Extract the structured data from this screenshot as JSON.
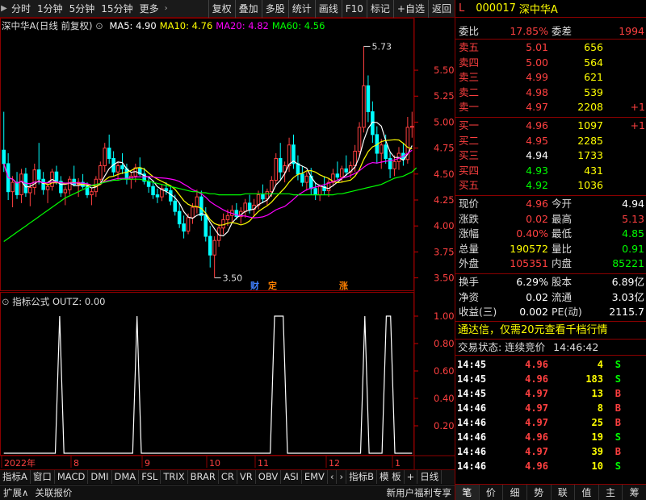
{
  "toolbar": {
    "left_items": [
      "分时",
      "1分钟",
      "5分钟",
      "15分钟",
      "更多"
    ],
    "right_items": [
      "复权",
      "叠加",
      "多股",
      "统计",
      "画线",
      "F10",
      "标记",
      "+自选",
      "返回"
    ]
  },
  "main_chart": {
    "stock_label": "深中华A(日线 前复权)",
    "ma": [
      {
        "label": "MA5: 4.90",
        "color": "#ffffff"
      },
      {
        "label": "MA10: 4.76",
        "color": "#ffff00"
      },
      {
        "label": "MA20: 4.82",
        "color": "#ff00ff"
      },
      {
        "label": "MA60: 4.56",
        "color": "#00ff00"
      }
    ],
    "high_label": "5.73",
    "low_label": "3.50",
    "markers": [
      "财",
      "定",
      "涨"
    ]
  },
  "chart_data": [
    {
      "type": "candlestick",
      "x_axis_labels": [
        "2022年",
        "8",
        "9",
        "10",
        "11",
        "12",
        "1"
      ],
      "y_ticks": [
        3.5,
        3.75,
        4.0,
        4.25,
        4.5,
        4.75,
        5.0,
        5.25,
        5.5
      ],
      "ylim": [
        3.38,
        5.85
      ],
      "ohlc": [
        [
          4.73,
          5.1,
          4.52,
          4.6
        ],
        [
          4.6,
          4.7,
          4.25,
          4.33
        ],
        [
          4.33,
          4.48,
          4.18,
          4.42
        ],
        [
          4.42,
          4.52,
          4.26,
          4.3
        ],
        [
          4.3,
          4.55,
          4.22,
          4.5
        ],
        [
          4.5,
          4.56,
          4.28,
          4.32
        ],
        [
          4.32,
          4.4,
          4.19,
          4.37
        ],
        [
          4.37,
          4.6,
          4.3,
          4.54
        ],
        [
          4.54,
          4.8,
          4.4,
          4.45
        ],
        [
          4.45,
          4.52,
          4.3,
          4.35
        ],
        [
          4.35,
          4.42,
          4.22,
          4.38
        ],
        [
          4.38,
          4.55,
          4.34,
          4.52
        ],
        [
          4.52,
          4.58,
          4.4,
          4.43
        ],
        [
          4.43,
          4.48,
          4.28,
          4.32
        ],
        [
          4.32,
          4.38,
          4.2,
          4.35
        ],
        [
          4.35,
          4.48,
          4.3,
          4.45
        ],
        [
          4.45,
          4.58,
          4.38,
          4.4
        ],
        [
          4.4,
          4.46,
          4.28,
          4.42
        ],
        [
          4.42,
          4.5,
          4.36,
          4.38
        ],
        [
          4.38,
          4.42,
          4.27,
          4.3
        ],
        [
          4.3,
          4.36,
          4.2,
          4.33
        ],
        [
          4.33,
          4.48,
          4.28,
          4.45
        ],
        [
          4.45,
          4.62,
          4.4,
          4.58
        ],
        [
          4.58,
          4.8,
          4.52,
          4.75
        ],
        [
          4.75,
          4.88,
          4.6,
          4.65
        ],
        [
          4.65,
          4.72,
          4.48,
          4.52
        ],
        [
          4.52,
          4.62,
          4.44,
          4.58
        ],
        [
          4.58,
          4.7,
          4.5,
          4.55
        ],
        [
          4.55,
          4.6,
          4.4,
          4.45
        ],
        [
          4.45,
          4.52,
          4.36,
          4.48
        ],
        [
          4.48,
          4.6,
          4.42,
          4.56
        ],
        [
          4.56,
          4.66,
          4.48,
          4.5
        ],
        [
          4.5,
          4.56,
          4.4,
          4.43
        ],
        [
          4.43,
          4.48,
          4.32,
          4.38
        ],
        [
          4.38,
          4.44,
          4.26,
          4.3
        ],
        [
          4.3,
          4.36,
          4.22,
          4.28
        ],
        [
          4.28,
          4.4,
          4.24,
          4.36
        ],
        [
          4.36,
          4.42,
          4.3,
          4.34
        ],
        [
          4.34,
          4.38,
          4.2,
          4.24
        ],
        [
          4.24,
          4.3,
          4.1,
          4.14
        ],
        [
          4.14,
          4.22,
          3.98,
          4.02
        ],
        [
          4.02,
          4.1,
          3.88,
          3.95
        ],
        [
          3.95,
          4.12,
          3.92,
          4.08
        ],
        [
          4.08,
          4.22,
          4.02,
          4.18
        ],
        [
          4.18,
          4.35,
          4.12,
          4.28
        ],
        [
          4.28,
          4.34,
          4.05,
          4.1
        ],
        [
          4.1,
          4.18,
          3.85,
          3.9
        ],
        [
          3.9,
          4.0,
          3.6,
          3.72
        ],
        [
          3.72,
          3.9,
          3.5,
          3.86
        ],
        [
          3.86,
          4.02,
          3.8,
          3.98
        ],
        [
          3.98,
          4.12,
          3.92,
          4.06
        ],
        [
          4.06,
          4.16,
          4.0,
          4.1
        ],
        [
          4.1,
          4.2,
          4.04,
          4.15
        ],
        [
          4.15,
          4.22,
          4.06,
          4.09
        ],
        [
          4.09,
          4.18,
          4.02,
          4.14
        ],
        [
          4.14,
          4.26,
          4.08,
          4.22
        ],
        [
          4.22,
          4.3,
          4.12,
          4.16
        ],
        [
          4.16,
          4.26,
          4.1,
          4.2
        ],
        [
          4.2,
          4.34,
          4.16,
          4.3
        ],
        [
          4.3,
          4.4,
          4.22,
          4.26
        ],
        [
          4.26,
          4.36,
          4.2,
          4.33
        ],
        [
          4.33,
          4.48,
          4.28,
          4.44
        ],
        [
          4.44,
          4.7,
          4.4,
          4.65
        ],
        [
          4.65,
          4.8,
          4.45,
          4.52
        ],
        [
          4.52,
          4.62,
          4.42,
          4.58
        ],
        [
          4.58,
          4.85,
          4.52,
          4.78
        ],
        [
          4.78,
          4.88,
          4.55,
          4.6
        ],
        [
          4.6,
          4.68,
          4.44,
          4.5
        ],
        [
          4.5,
          4.58,
          4.38,
          4.42
        ],
        [
          4.42,
          4.52,
          4.34,
          4.48
        ],
        [
          4.48,
          4.56,
          4.3,
          4.36
        ],
        [
          4.36,
          4.42,
          4.25,
          4.3
        ],
        [
          4.3,
          4.4,
          4.24,
          4.38
        ],
        [
          4.38,
          4.48,
          4.3,
          4.34
        ],
        [
          4.34,
          4.46,
          4.28,
          4.42
        ],
        [
          4.42,
          4.55,
          4.38,
          4.5
        ],
        [
          4.5,
          4.62,
          4.44,
          4.47
        ],
        [
          4.47,
          4.58,
          4.42,
          4.55
        ],
        [
          4.55,
          4.68,
          4.48,
          4.52
        ],
        [
          4.52,
          4.62,
          4.46,
          4.58
        ],
        [
          4.58,
          4.78,
          4.52,
          4.72
        ],
        [
          4.72,
          5.0,
          4.66,
          4.95
        ],
        [
          4.95,
          5.73,
          4.9,
          5.35
        ],
        [
          5.35,
          5.45,
          5.0,
          5.1
        ],
        [
          5.1,
          5.2,
          4.8,
          4.88
        ],
        [
          4.88,
          4.96,
          4.6,
          4.7
        ],
        [
          4.7,
          4.84,
          4.55,
          4.78
        ],
        [
          4.78,
          4.88,
          4.6,
          4.65
        ],
        [
          4.65,
          4.72,
          4.46,
          4.55
        ],
        [
          4.55,
          4.68,
          4.48,
          4.62
        ],
        [
          4.62,
          4.76,
          4.54,
          4.7
        ],
        [
          4.7,
          4.8,
          4.58,
          4.64
        ],
        [
          4.64,
          5.05,
          4.6,
          4.95
        ],
        [
          4.95,
          5.1,
          4.85,
          4.96
        ]
      ],
      "ma_series": [
        {
          "label": "MA5",
          "color": "#ffffff"
        },
        {
          "label": "MA10",
          "color": "#ffff00"
        },
        {
          "label": "MA20",
          "color": "#ff00ff"
        },
        {
          "label": "MA60",
          "color": "#00ff00",
          "values": [
            3.85,
            3.88,
            3.91,
            3.94,
            3.97,
            4.0,
            4.03,
            4.06,
            4.09,
            4.12,
            4.15,
            4.18,
            4.21,
            4.24,
            4.27,
            4.29,
            4.31,
            4.33,
            4.35,
            4.37,
            4.39,
            4.4,
            4.41,
            4.42,
            4.43,
            4.44,
            4.44,
            4.45,
            4.45,
            4.45,
            4.45,
            4.45,
            4.44,
            4.43,
            4.42,
            4.41,
            4.4,
            4.39,
            4.38,
            4.37,
            4.36,
            4.35,
            4.34,
            4.33,
            4.33,
            4.32,
            4.32,
            4.31,
            4.31,
            4.3,
            4.3,
            4.3,
            4.3,
            4.3,
            4.3,
            4.31,
            4.31,
            4.31,
            4.31,
            4.31,
            4.31,
            4.31,
            4.31,
            4.31,
            4.31,
            4.31,
            4.3,
            4.3,
            4.3,
            4.3,
            4.3,
            4.3,
            4.3,
            4.3,
            4.3,
            4.3,
            4.31,
            4.31,
            4.32,
            4.33,
            4.34,
            4.35,
            4.36,
            4.37,
            4.38,
            4.39,
            4.4,
            4.42,
            4.44,
            4.46,
            4.47,
            4.48,
            4.5,
            4.52,
            4.56
          ]
        }
      ]
    },
    {
      "type": "line",
      "title": "指标公式 OUTZ: 0.00",
      "y_ticks": [
        0.2,
        0.4,
        0.6,
        0.8,
        1.0
      ],
      "ylim": [
        0,
        1.1
      ],
      "values": [
        0,
        0,
        0,
        0,
        0,
        0,
        0,
        0,
        0,
        0,
        0,
        0,
        0,
        1,
        0,
        0,
        0,
        0,
        0,
        0,
        0,
        0,
        0,
        0,
        0,
        0,
        0,
        0,
        0,
        0,
        0,
        1,
        0,
        0,
        0,
        0,
        0,
        0,
        0,
        0,
        0,
        0,
        0,
        0,
        0,
        0,
        0,
        0,
        0,
        0,
        0,
        0,
        0,
        0,
        0,
        0,
        0,
        0,
        0,
        0,
        0,
        0,
        0,
        1,
        1,
        1,
        0,
        0,
        0,
        0,
        0,
        0,
        0,
        0,
        0,
        0,
        0,
        0,
        0,
        0,
        0,
        0,
        0,
        0,
        1,
        0,
        0,
        0,
        0,
        1,
        1,
        0,
        0,
        0,
        0,
        0
      ]
    }
  ],
  "indicator": {
    "title": "指标公式 OUTZ: 0.00"
  },
  "bottom_tabs": [
    "指标A",
    "窗口",
    "MACD",
    "DMI",
    "DMA",
    "FSL",
    "TRIX",
    "BRAR",
    "CR",
    "VR",
    "OBV",
    "ASI",
    "EMV",
    "‹",
    "›",
    "指标B",
    "模 板",
    "+",
    "日线"
  ],
  "status_bar": {
    "left": [
      "扩展∧",
      "关联报价"
    ],
    "right": "新用户福利专享"
  },
  "quote": {
    "marker": "L",
    "code": "000017",
    "name": "深中华A",
    "weibi_label": "委比",
    "weibi": "17.85%",
    "weicha_label": "委差",
    "weicha": "1994",
    "sells": [
      {
        "label": "卖五",
        "price": "5.01",
        "vol": "656",
        "chg": "",
        "color": "#ff4040"
      },
      {
        "label": "卖四",
        "price": "5.00",
        "vol": "564",
        "chg": "",
        "color": "#ff4040"
      },
      {
        "label": "卖三",
        "price": "4.99",
        "vol": "621",
        "chg": "",
        "color": "#ff4040"
      },
      {
        "label": "卖二",
        "price": "4.98",
        "vol": "539",
        "chg": "",
        "color": "#ff4040"
      },
      {
        "label": "卖一",
        "price": "4.97",
        "vol": "2208",
        "chg": "+1",
        "color": "#ff4040"
      }
    ],
    "buys": [
      {
        "label": "买一",
        "price": "4.96",
        "vol": "1097",
        "chg": "+1",
        "color": "#ff4040"
      },
      {
        "label": "买二",
        "price": "4.95",
        "vol": "2285",
        "chg": "",
        "color": "#ff4040"
      },
      {
        "label": "买三",
        "price": "4.94",
        "vol": "1733",
        "chg": "",
        "color": "#ffffff"
      },
      {
        "label": "买四",
        "price": "4.93",
        "vol": "431",
        "chg": "",
        "color": "#00ff00"
      },
      {
        "label": "买五",
        "price": "4.92",
        "vol": "1036",
        "chg": "",
        "color": "#00ff00"
      }
    ],
    "stats1": [
      {
        "l1": "现价",
        "v1": "4.96",
        "c1": "#ff4040",
        "l2": "今开",
        "v2": "4.94",
        "c2": "#ffffff"
      },
      {
        "l1": "涨跌",
        "v1": "0.02",
        "c1": "#ff4040",
        "l2": "最高",
        "v2": "5.13",
        "c2": "#ff4040"
      },
      {
        "l1": "涨幅",
        "v1": "0.40%",
        "c1": "#ff4040",
        "l2": "最低",
        "v2": "4.85",
        "c2": "#00ff00"
      },
      {
        "l1": "总量",
        "v1": "190572",
        "c1": "#ffff00",
        "l2": "量比",
        "v2": "0.91",
        "c2": "#00ff00"
      },
      {
        "l1": "外盘",
        "v1": "105351",
        "c1": "#ff4040",
        "l2": "内盘",
        "v2": "85221",
        "c2": "#00ff00"
      }
    ],
    "stats2": [
      {
        "l1": "换手",
        "v1": "6.29%",
        "c1": "#ffffff",
        "l2": "股本",
        "v2": "6.89亿",
        "c2": "#ffffff"
      },
      {
        "l1": "净资",
        "v1": "0.02",
        "c1": "#ffffff",
        "l2": "流通",
        "v2": "3.03亿",
        "c2": "#ffffff"
      },
      {
        "l1": "收益(三)",
        "v1": "0.002",
        "c1": "#ffffff",
        "l2": "PE(动)",
        "v2": "2115.7",
        "c2": "#ffffff"
      }
    ],
    "promo": "通达信，仅需20元查看千档行情",
    "trade_state_label": "交易状态: 连续竞价",
    "trade_time": "14:46:42",
    "ticks": [
      {
        "time": "14:45",
        "price": "4.96",
        "vol": "4",
        "side": "S"
      },
      {
        "time": "14:45",
        "price": "4.96",
        "vol": "183",
        "side": "S"
      },
      {
        "time": "14:45",
        "price": "4.97",
        "vol": "13",
        "side": "B"
      },
      {
        "time": "14:46",
        "price": "4.97",
        "vol": "8",
        "side": "B"
      },
      {
        "time": "14:46",
        "price": "4.97",
        "vol": "25",
        "side": "B"
      },
      {
        "time": "14:46",
        "price": "4.96",
        "vol": "19",
        "side": "S"
      },
      {
        "time": "14:46",
        "price": "4.97",
        "vol": "39",
        "side": "B"
      },
      {
        "time": "14:46",
        "price": "4.96",
        "vol": "10",
        "side": "S"
      }
    ],
    "tabs": [
      "笔",
      "价",
      "细",
      "势",
      "联",
      "值",
      "主",
      "筹"
    ]
  }
}
